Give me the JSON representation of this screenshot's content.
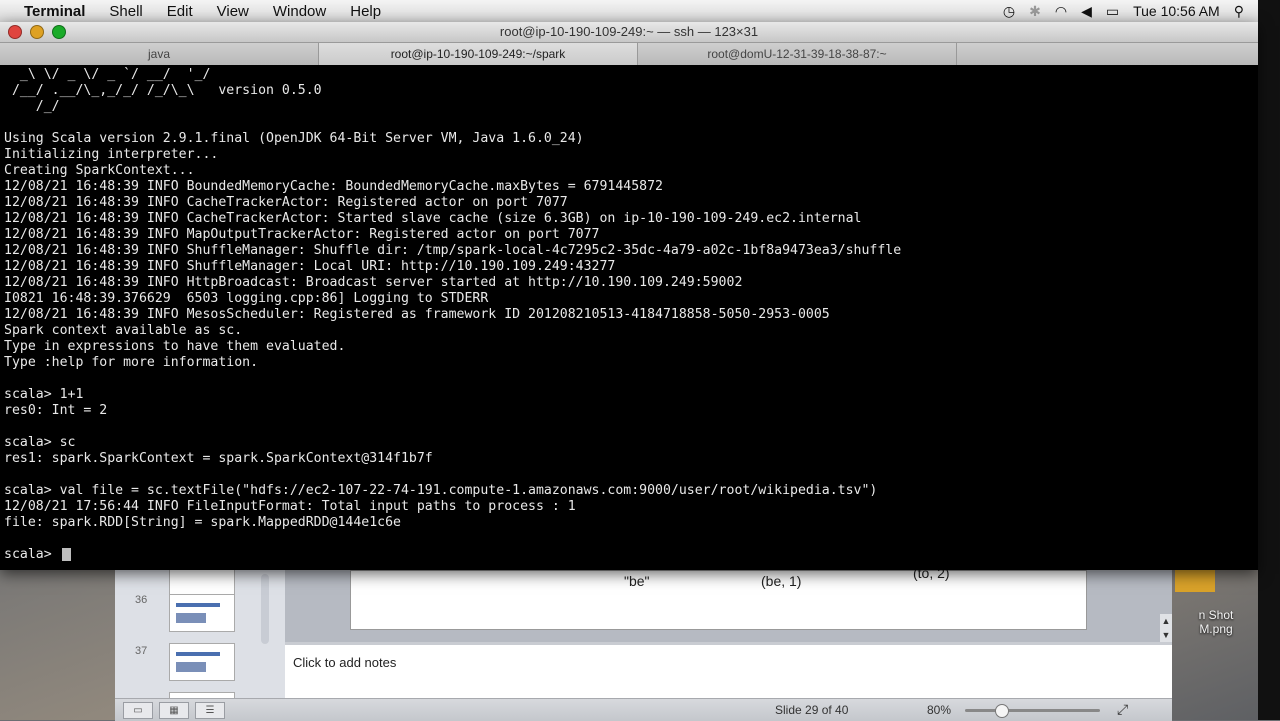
{
  "menubar": {
    "app": "Terminal",
    "menus": [
      "Shell",
      "Edit",
      "View",
      "Window",
      "Help"
    ],
    "clock": "Tue 10:56 AM",
    "icons": [
      "time-machine-icon",
      "bluetooth-icon",
      "wifi-icon",
      "volume-icon",
      "battery-icon",
      "spotlight-icon"
    ]
  },
  "terminal": {
    "title": "root@ip-10-190-109-249:~ — ssh — 123×31",
    "tabs": [
      "java",
      "root@ip-10-190-109-249:~/spark",
      "root@domU-12-31-39-18-38-87:~"
    ],
    "active_tab": 1,
    "lines": [
      "  _\\ \\/ _ \\/ _ `/ __/  '_/",
      " /__/ .__/\\_,_/_/ /_/\\_\\   version 0.5.0",
      "    /_/",
      "",
      "Using Scala version 2.9.1.final (OpenJDK 64-Bit Server VM, Java 1.6.0_24)",
      "Initializing interpreter...",
      "Creating SparkContext...",
      "12/08/21 16:48:39 INFO BoundedMemoryCache: BoundedMemoryCache.maxBytes = 6791445872",
      "12/08/21 16:48:39 INFO CacheTrackerActor: Registered actor on port 7077",
      "12/08/21 16:48:39 INFO CacheTrackerActor: Started slave cache (size 6.3GB) on ip-10-190-109-249.ec2.internal",
      "12/08/21 16:48:39 INFO MapOutputTrackerActor: Registered actor on port 7077",
      "12/08/21 16:48:39 INFO ShuffleManager: Shuffle dir: /tmp/spark-local-4c7295c2-35dc-4a79-a02c-1bf8a9473ea3/shuffle",
      "12/08/21 16:48:39 INFO ShuffleManager: Local URI: http://10.190.109.249:43277",
      "12/08/21 16:48:39 INFO HttpBroadcast: Broadcast server started at http://10.190.109.249:59002",
      "I0821 16:48:39.376629  6503 logging.cpp:86] Logging to STDERR",
      "12/08/21 16:48:39 INFO MesosScheduler: Registered as framework ID 201208210513-4184718858-5050-2953-0005",
      "Spark context available as sc.",
      "Type in expressions to have them evaluated.",
      "Type :help for more information.",
      "",
      "scala> 1+1",
      "res0: Int = 2",
      "",
      "scala> sc",
      "res1: spark.SparkContext = spark.SparkContext@314f1b7f",
      "",
      "scala> val file = sc.textFile(\"hdfs://ec2-107-22-74-191.compute-1.amazonaws.com:9000/user/root/wikipedia.tsv\")",
      "12/08/21 17:56:44 INFO FileInputFormat: Total input paths to process : 1",
      "file: spark.RDD[String] = spark.MappedRDD@144e1c6e",
      ""
    ],
    "prompt": "scala> "
  },
  "keynote": {
    "thumb_numbers": [
      "36",
      "37"
    ],
    "slide_texts": [
      "\"be\"",
      "(be, 1)",
      "(to, 2)"
    ],
    "notes_placeholder": "Click to add notes",
    "slide_counter": "Slide 29 of 40",
    "zoom": "80%"
  },
  "desktop": {
    "file_label": "n Shot\nM.png"
  }
}
